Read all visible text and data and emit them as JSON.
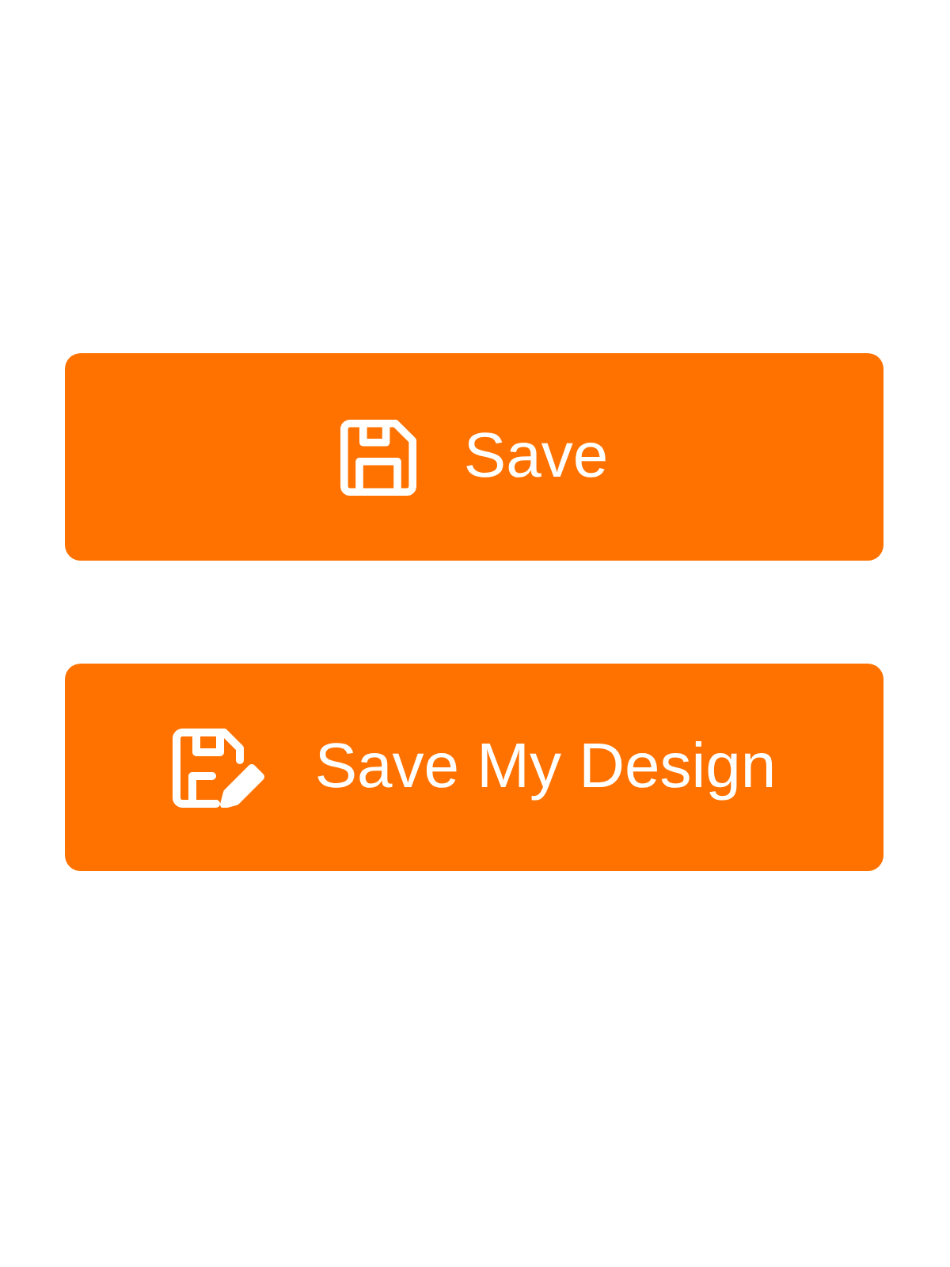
{
  "buttons": [
    {
      "kind": "save",
      "label": "Save"
    },
    {
      "kind": "edit",
      "label": "Save My Design"
    }
  ]
}
